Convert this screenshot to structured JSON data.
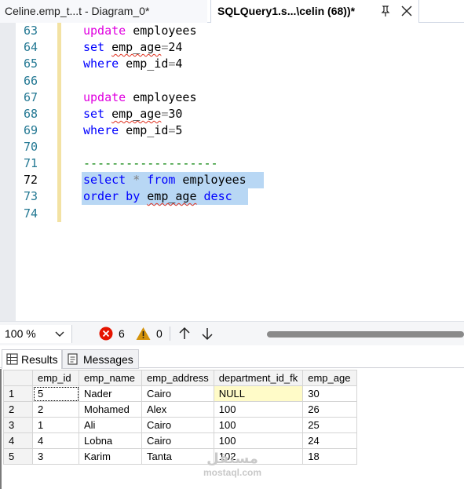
{
  "tabs": [
    {
      "label": "Celine.emp_t...t - Diagram_0*",
      "active": false
    },
    {
      "label": "SQLQuery1.s...\\celin (68))*",
      "active": true
    }
  ],
  "editor": {
    "lines": [
      {
        "no": "63",
        "current": false
      },
      {
        "no": "64",
        "current": false
      },
      {
        "no": "65",
        "current": false
      },
      {
        "no": "66",
        "current": false
      },
      {
        "no": "67",
        "current": false
      },
      {
        "no": "68",
        "current": false
      },
      {
        "no": "69",
        "current": false
      },
      {
        "no": "70",
        "current": false
      },
      {
        "no": "71",
        "current": false
      },
      {
        "no": "72",
        "current": true
      },
      {
        "no": "73",
        "current": false
      },
      {
        "no": "74",
        "current": false
      }
    ],
    "code": {
      "l63_kw": "update",
      "l63_rest": " employees",
      "l64_kw": "set",
      "l64_col": "emp_age",
      "l64_op": "=",
      "l64_val": "24",
      "l65_kw": "where",
      "l65_col": " emp_id",
      "l65_op": "=",
      "l65_val": "4",
      "l67_kw": "update",
      "l67_rest": " employees",
      "l68_kw": "set",
      "l68_col": "emp_age",
      "l68_op": "=",
      "l68_val": "30",
      "l69_kw": "where",
      "l69_col": " emp_id",
      "l69_op": "=",
      "l69_val": "5",
      "l71_comment": "-------------------",
      "l72_kw1": "select",
      "l72_star": "*",
      "l72_kw2": "from",
      "l72_rest": " employees",
      "l73_kw": "order by",
      "l73_col": "emp_age",
      "l73_kw2": "desc"
    }
  },
  "toolbar": {
    "zoom": "100 %",
    "errors": "6",
    "warnings": "0"
  },
  "results": {
    "tabs": [
      "Results",
      "Messages"
    ],
    "columns": [
      "emp_id",
      "emp_name",
      "emp_address",
      "department_id_fk",
      "emp_age"
    ],
    "rows": [
      {
        "n": "1",
        "emp_id": "5",
        "emp_name": "Nader",
        "emp_address": "Cairo",
        "department_id_fk": "NULL",
        "emp_age": "30"
      },
      {
        "n": "2",
        "emp_id": "2",
        "emp_name": "Mohamed",
        "emp_address": "Alex",
        "department_id_fk": "100",
        "emp_age": "26"
      },
      {
        "n": "3",
        "emp_id": "1",
        "emp_name": "Ali",
        "emp_address": "Cairo",
        "department_id_fk": "100",
        "emp_age": "25"
      },
      {
        "n": "4",
        "emp_id": "4",
        "emp_name": "Lobna",
        "emp_address": "Cairo",
        "department_id_fk": "100",
        "emp_age": "24"
      },
      {
        "n": "5",
        "emp_id": "3",
        "emp_name": "Karim",
        "emp_address": "Tanta",
        "department_id_fk": "102",
        "emp_age": "18"
      }
    ]
  },
  "watermark": {
    "arabic": "مستقل",
    "latin": "mostaql.com"
  },
  "colors": {
    "keyword_pink": "#e000e0",
    "keyword_blue": "#0000ff",
    "comment": "#008000",
    "selection": "#b8d7f4",
    "null_cell": "#fffbc8"
  }
}
